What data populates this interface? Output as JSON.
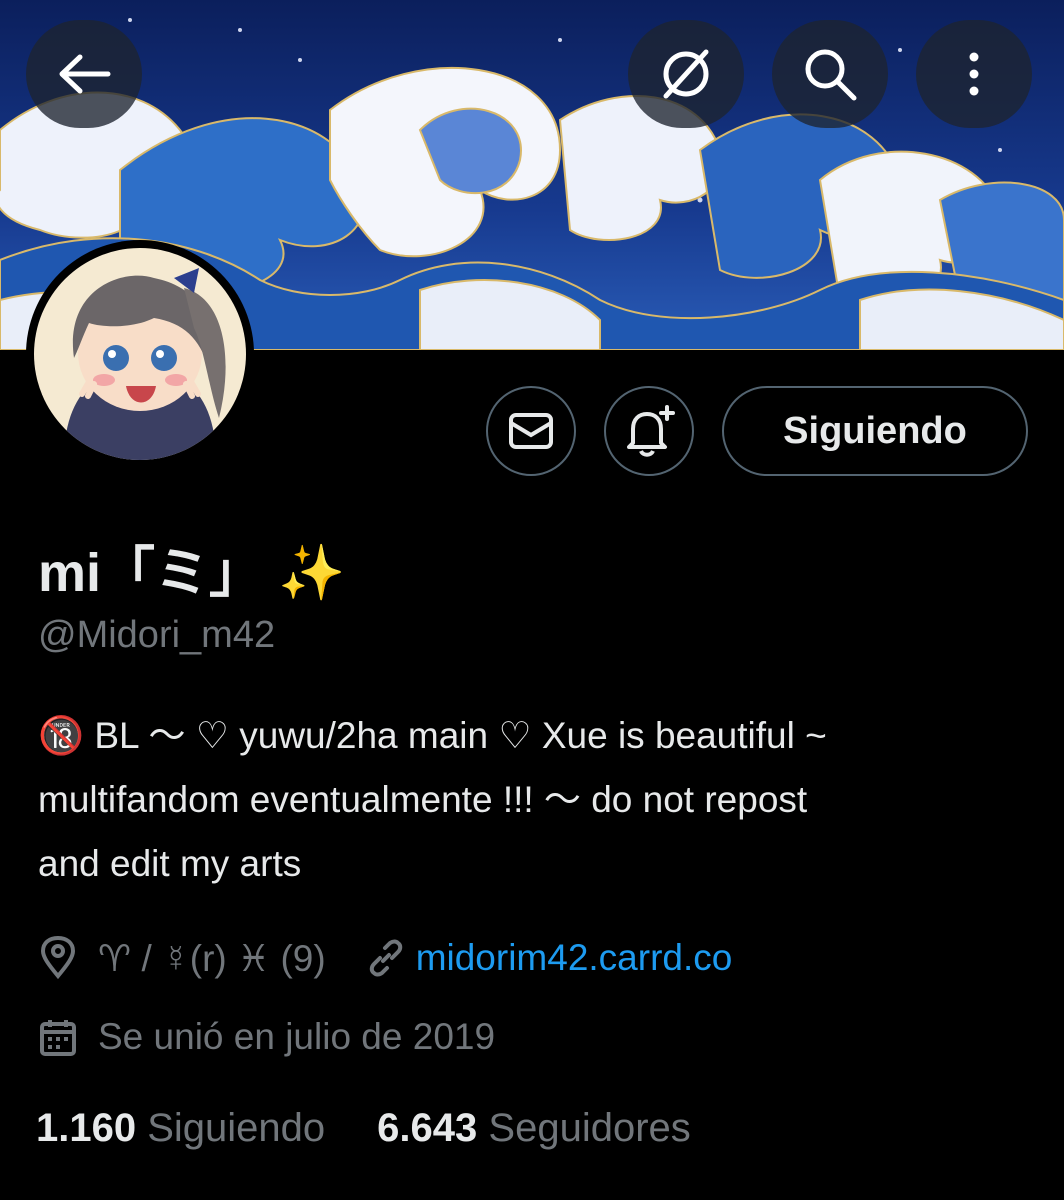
{
  "header": {
    "back_icon": "arrow-left-icon",
    "grok_icon": "grok-icon",
    "search_icon": "search-icon",
    "more_icon": "more-vertical-icon"
  },
  "actions": {
    "message_icon": "envelope-icon",
    "notify_icon": "bell-plus-icon",
    "follow_label": "Siguiendo"
  },
  "profile": {
    "display_name": "mi「ミ」 ✨",
    "handle": "@Midori_m42",
    "bio_lines": [
      "🔞 BL 〜  ♡ yuwu/2ha main ♡  Xue is beautiful ~",
      "multifandom eventualmente !!! 〜 do not repost",
      "and edit my arts"
    ],
    "location": "♈ / ☿(r) ♓ (9)",
    "website": "midorim42.carrd.co",
    "joined": "Se unió en julio de 2019"
  },
  "stats": {
    "following_count": "1.160",
    "following_label": "Siguiendo",
    "followers_count": "6.643",
    "followers_label": "Seguidores"
  },
  "colors": {
    "background": "#000000",
    "text": "#e7e9ea",
    "muted": "#71767b",
    "link": "#1d9bf0",
    "border": "#536471"
  }
}
